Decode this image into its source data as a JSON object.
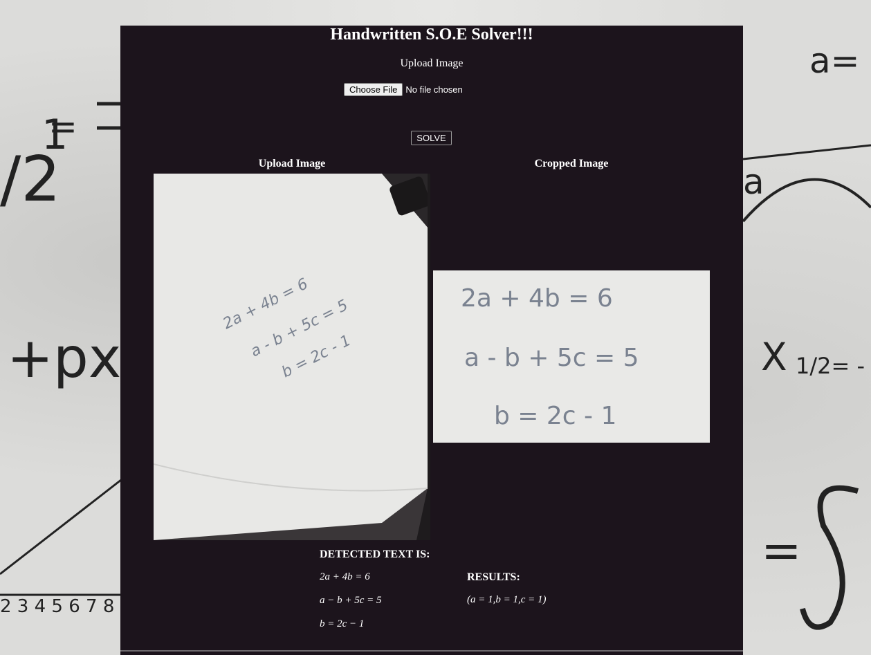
{
  "header": {
    "title": "Handwritten S.O.E Solver!!!"
  },
  "upload": {
    "label": "Upload Image",
    "choose_file_label": "Choose File",
    "file_status": "No file chosen"
  },
  "solve_button": {
    "label": "SOLVE"
  },
  "images": {
    "upload_title": "Upload Image",
    "cropped_title": "Cropped Image",
    "handwritten_equations": [
      "2a + 4b = 6",
      "a - b + 5c = 5",
      "b = 2c - 1"
    ]
  },
  "detected": {
    "title": "DETECTED TEXT IS:",
    "equations": [
      "2a + 4b = 6",
      "a − b + 5c = 5",
      "b = 2c − 1"
    ]
  },
  "results": {
    "title": "RESULTS:",
    "value": "(a = 1,b = 1,c = 1)"
  },
  "colors": {
    "panel": "#1c141c",
    "text": "#ffffff",
    "paper": "#e9e9e7"
  }
}
